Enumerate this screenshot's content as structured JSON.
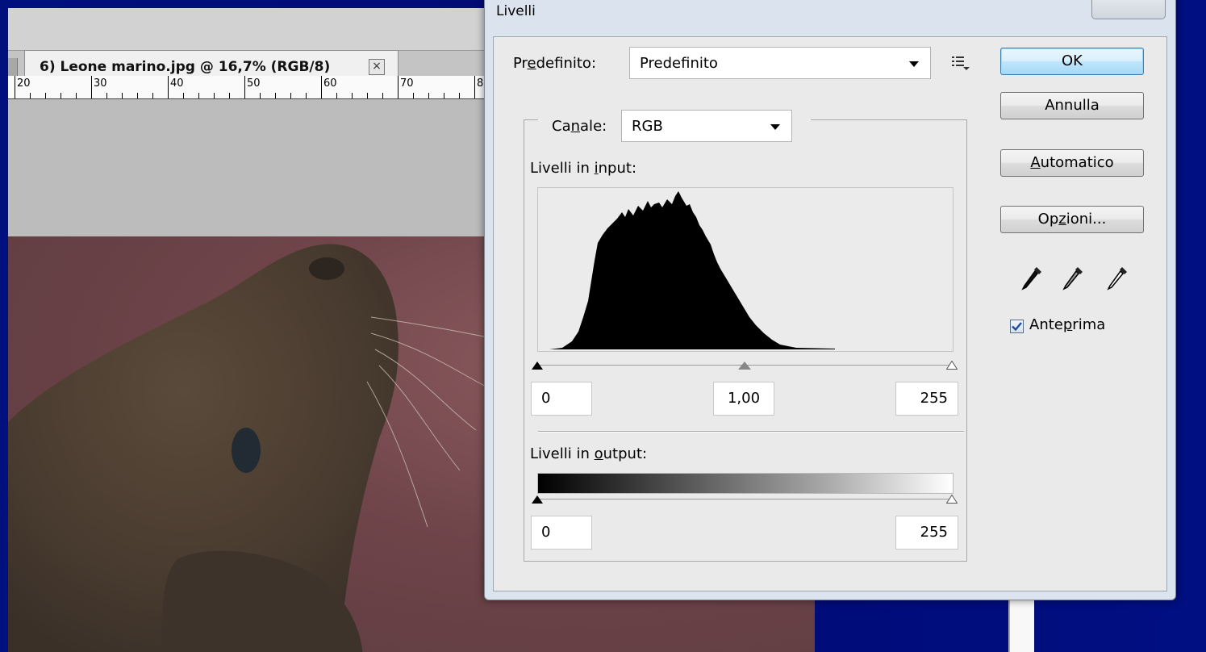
{
  "document": {
    "tab_label": "6) Leone marino.jpg @ 16,7% (RGB/8)",
    "tab_close": "×",
    "ruler_labels": [
      "20",
      "30",
      "40",
      "50",
      "60",
      "70",
      "8"
    ]
  },
  "dialog": {
    "title": "Livelli",
    "preset_label_pre": "Pr",
    "preset_label_u": "e",
    "preset_label_post": "definito:",
    "preset_value": "Predefinito",
    "channel_label_pre": "Ca",
    "channel_label_u": "n",
    "channel_label_post": "ale:",
    "channel_value": "RGB",
    "input_levels_pre": "Livelli in ",
    "input_levels_u": "i",
    "input_levels_post": "nput:",
    "input_black": "0",
    "input_gamma": "1,00",
    "input_white": "255",
    "output_levels_pre": "Livelli in ",
    "output_levels_u": "o",
    "output_levels_post": "utput:",
    "output_black": "0",
    "output_white": "255",
    "buttons": {
      "ok": "OK",
      "cancel": "Annulla",
      "auto_u": "A",
      "auto_post": "utomatico",
      "options_pre": "Op",
      "options_u": "z",
      "options_post": "ioni..."
    },
    "preview_pre": "Ante",
    "preview_u": "p",
    "preview_post": "rima",
    "preview_checked": true,
    "icons": [
      "black-eyedropper-icon",
      "gray-eyedropper-icon",
      "white-eyedropper-icon",
      "preset-menu-icon"
    ]
  }
}
